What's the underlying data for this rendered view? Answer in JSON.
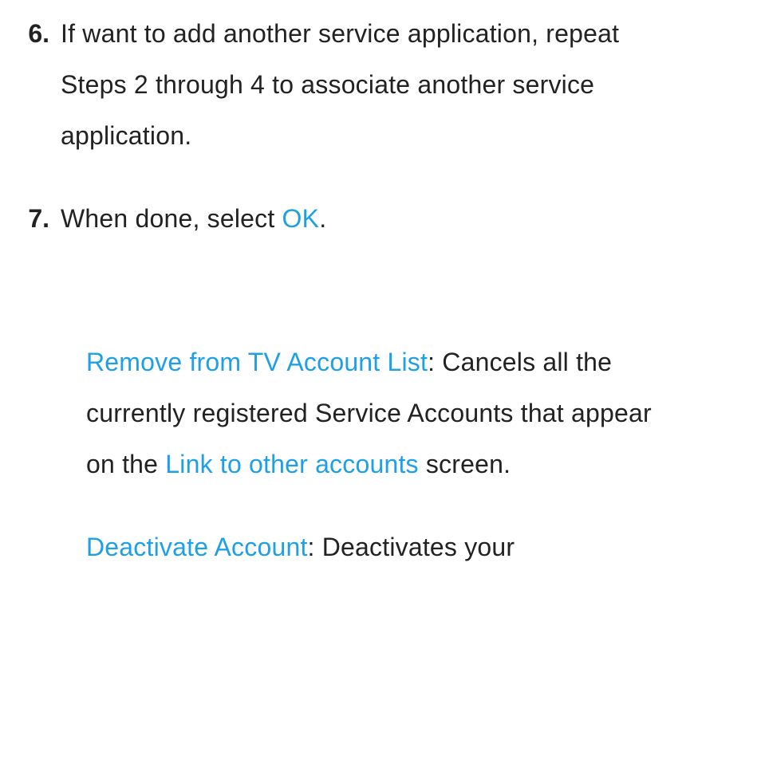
{
  "steps": [
    {
      "num": "6.",
      "text": "If want to add another service application, repeat Steps 2 through 4 to associate another service application."
    },
    {
      "num": "7.",
      "prefix": "When done, select ",
      "highlight": "OK",
      "suffix": "."
    }
  ],
  "paragraphs": [
    {
      "lead": "Remove from TV Account List",
      "after_lead": ": Cancels all the currently registered Service Accounts that appear on the ",
      "hl2": "Link to other accounts",
      "tail": " screen."
    },
    {
      "lead": "Deactivate Account",
      "after_lead": ": Deactivates your"
    }
  ]
}
